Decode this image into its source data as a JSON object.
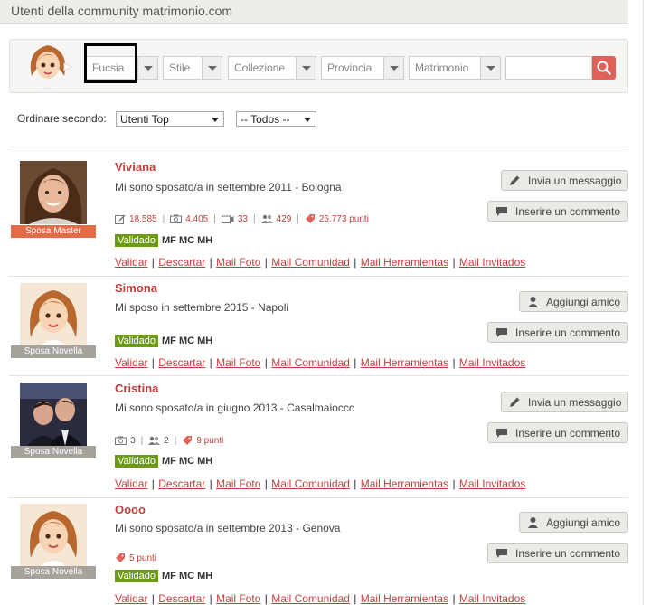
{
  "header": {
    "title": "Utenti della community matrimonio.com"
  },
  "filters": [
    {
      "value": "Fucsia"
    },
    {
      "value": "Stile"
    },
    {
      "value": "Collezione"
    },
    {
      "value": "Provincia"
    },
    {
      "value": "Matrimonio"
    }
  ],
  "search": {
    "placeholder": ""
  },
  "sort": {
    "label": "Ordinare secondo:",
    "primary": "Utenti Top",
    "secondary": "-- Todos --"
  },
  "buttons": {
    "message": "Invia un messaggio",
    "comment": "Inserire un commento",
    "friend": "Aggiungi amico"
  },
  "links": [
    "Validar",
    "Descartar",
    "Mail Foto",
    "Mail Comunidad",
    "Mail Herramientas",
    "Mail Invitados"
  ],
  "validated": {
    "badge": "Validado",
    "tags": "MF MC MH"
  },
  "users": [
    {
      "name": "Viviana",
      "desc": "Mi sono sposato/a in settembre 2011 - Bologna",
      "rank": "Sposa Master",
      "stats": {
        "posts": "18.585",
        "photos": "4.405",
        "videos": "33",
        "friends": "429",
        "points": "26.773 punti"
      }
    },
    {
      "name": "Simona",
      "desc": "Mi sposo in settembre 2015 - Napoli",
      "rank": "Sposa Novella"
    },
    {
      "name": "Cristina",
      "desc": "Mi sono sposato/a in giugno 2013 - Casalmaiocco",
      "rank": "Sposa Novella",
      "stats": {
        "photos": "3",
        "friends": "2",
        "points": "9 punti"
      }
    },
    {
      "name": "Oooo",
      "desc": "Mi sono sposato/a in settembre 2013 - Genova",
      "rank": "Sposa Novella",
      "stats": {
        "points": "5 punti"
      }
    }
  ],
  "colors": {
    "accent": "#c0403d",
    "valid": "#6d9b12",
    "search": "#e0605a"
  }
}
